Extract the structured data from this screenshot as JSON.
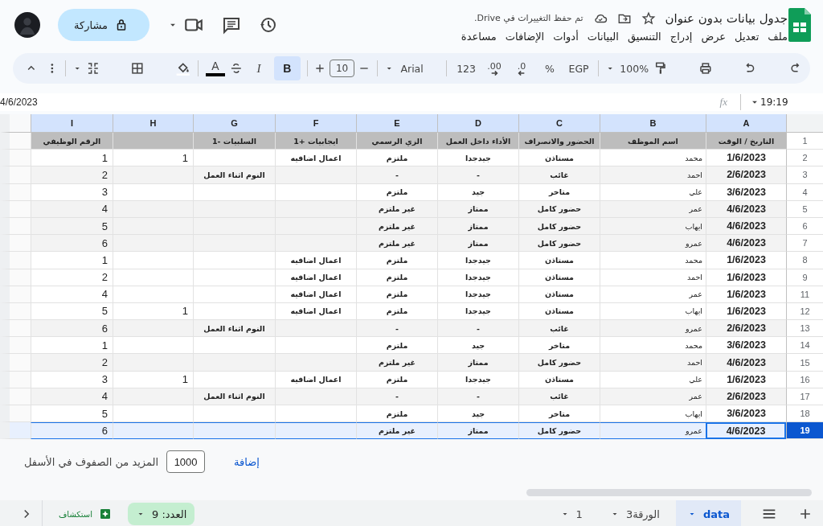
{
  "app": {
    "title": "جدول بيانات بدون عنوان",
    "save_status": "تم حفظ التغييرات في Drive."
  },
  "menu": [
    "ملف",
    "تعديل",
    "عرض",
    "إدراج",
    "التنسيق",
    "البيانات",
    "أدوات",
    "الإضافات",
    "مساعدة"
  ],
  "share_button": {
    "label": "مشاركة"
  },
  "toolbar": {
    "zoom": "100%",
    "currency": "EGP",
    "percent": "%",
    "decimal_decrease": ".0",
    "decimal_increase": ".00",
    "number_format": "123",
    "font": "Arial",
    "font_size": "10",
    "bold": {
      "label": "B",
      "on": true
    },
    "italic": {
      "label": "I",
      "on": false
    },
    "text_color": {
      "label": "A",
      "color": "#000000"
    }
  },
  "formula_bar": {
    "name_box": "19:19",
    "fx": "fx",
    "value": "4/6/2023"
  },
  "sheet": {
    "columns": [
      "A",
      "B",
      "C",
      "D",
      "E",
      "F",
      "G",
      "H",
      "I"
    ],
    "header_row": {
      "number": "1",
      "cells": [
        "التاريخ / الوقت",
        "اسم الموظف",
        "الحضور والانصراف",
        "الأداء داخل العمل",
        "الزي الرسمي",
        "ايجابيات +1",
        "السلبيات -1",
        "",
        "الرقم الوظيفي"
      ]
    },
    "rows": [
      {
        "number": "2",
        "shaded": false,
        "selected": false,
        "cells": [
          "1/6/2023",
          "محمد",
          "مستاذن",
          "جيدجدا",
          "ملتزم",
          "اعمال اضافيه",
          "",
          "1",
          "1"
        ]
      },
      {
        "number": "3",
        "shaded": true,
        "selected": false,
        "cells": [
          "2/6/2023",
          "احمد",
          "غائب",
          "-",
          "-",
          "",
          "النوم اثناء العمل",
          "",
          "2"
        ]
      },
      {
        "number": "4",
        "shaded": false,
        "selected": false,
        "cells": [
          "3/6/2023",
          "علي",
          "متاخر",
          "جيد",
          "ملتزم",
          "",
          "",
          "",
          "3"
        ]
      },
      {
        "number": "5",
        "shaded": true,
        "selected": false,
        "cells": [
          "4/6/2023",
          "عمر",
          "حضور كامل",
          "ممتاز",
          "غير ملتزم",
          "",
          "",
          "",
          "4"
        ]
      },
      {
        "number": "6",
        "shaded": true,
        "selected": false,
        "cells": [
          "4/6/2023",
          "ايهاب",
          "حضور كامل",
          "ممتاز",
          "غير ملتزم",
          "",
          "",
          "",
          "5"
        ]
      },
      {
        "number": "7",
        "shaded": true,
        "selected": false,
        "cells": [
          "4/6/2023",
          "عمرو",
          "حضور كامل",
          "ممتاز",
          "غير ملتزم",
          "",
          "",
          "",
          "6"
        ]
      },
      {
        "number": "8",
        "shaded": false,
        "selected": false,
        "cells": [
          "1/6/2023",
          "محمد",
          "مستاذن",
          "جيدجدا",
          "ملتزم",
          "اعمال اضافيه",
          "",
          "",
          "1"
        ]
      },
      {
        "number": "9",
        "shaded": false,
        "selected": false,
        "cells": [
          "1/6/2023",
          "احمد",
          "مستاذن",
          "جيدجدا",
          "ملتزم",
          "اعمال اضافيه",
          "",
          "",
          "2"
        ]
      },
      {
        "number": "11",
        "shaded": false,
        "selected": false,
        "cells": [
          "1/6/2023",
          "عمر",
          "مستاذن",
          "جيدجدا",
          "ملتزم",
          "اعمال اضافيه",
          "",
          "",
          "4"
        ]
      },
      {
        "number": "12",
        "shaded": false,
        "selected": false,
        "cells": [
          "1/6/2023",
          "ايهاب",
          "مستاذن",
          "جيدجدا",
          "ملتزم",
          "اعمال اضافيه",
          "",
          "1",
          "5"
        ]
      },
      {
        "number": "13",
        "shaded": true,
        "selected": false,
        "cells": [
          "2/6/2023",
          "عمرو",
          "غائب",
          "-",
          "-",
          "",
          "النوم اثناء العمل",
          "",
          "6"
        ]
      },
      {
        "number": "14",
        "shaded": false,
        "selected": false,
        "cells": [
          "3/6/2023",
          "محمد",
          "متاخر",
          "جيد",
          "ملتزم",
          "",
          "",
          "",
          "1"
        ]
      },
      {
        "number": "15",
        "shaded": true,
        "selected": false,
        "cells": [
          "4/6/2023",
          "احمد",
          "حضور كامل",
          "ممتاز",
          "غير ملتزم",
          "",
          "",
          "",
          "2"
        ]
      },
      {
        "number": "16",
        "shaded": false,
        "selected": false,
        "cells": [
          "1/6/2023",
          "علي",
          "مستاذن",
          "جيدجدا",
          "ملتزم",
          "اعمال اضافيه",
          "",
          "1",
          "3"
        ]
      },
      {
        "number": "17",
        "shaded": true,
        "selected": false,
        "cells": [
          "2/6/2023",
          "عمر",
          "غائب",
          "-",
          "-",
          "",
          "النوم اثناء العمل",
          "",
          "4"
        ]
      },
      {
        "number": "18",
        "shaded": false,
        "selected": false,
        "cells": [
          "3/6/2023",
          "ايهاب",
          "متاخر",
          "جيد",
          "ملتزم",
          "",
          "",
          "",
          "5"
        ]
      },
      {
        "number": "19",
        "shaded": true,
        "selected": true,
        "cells": [
          "4/6/2023",
          "عمرو",
          "حضور كامل",
          "ممتاز",
          "غير ملتزم",
          "",
          "",
          "",
          "6"
        ]
      }
    ]
  },
  "footer": {
    "add_link": "إضافة",
    "rows_input": "1000",
    "text": "المزيد من الصفوف في الأسفل"
  },
  "bottom_bar": {
    "tabs": [
      {
        "label": "data",
        "selected": true
      },
      {
        "label": "الورقة3",
        "selected": false
      },
      {
        "label": "1",
        "selected": false
      }
    ],
    "count": "العدد: 9",
    "explore": "استكشاف"
  }
}
